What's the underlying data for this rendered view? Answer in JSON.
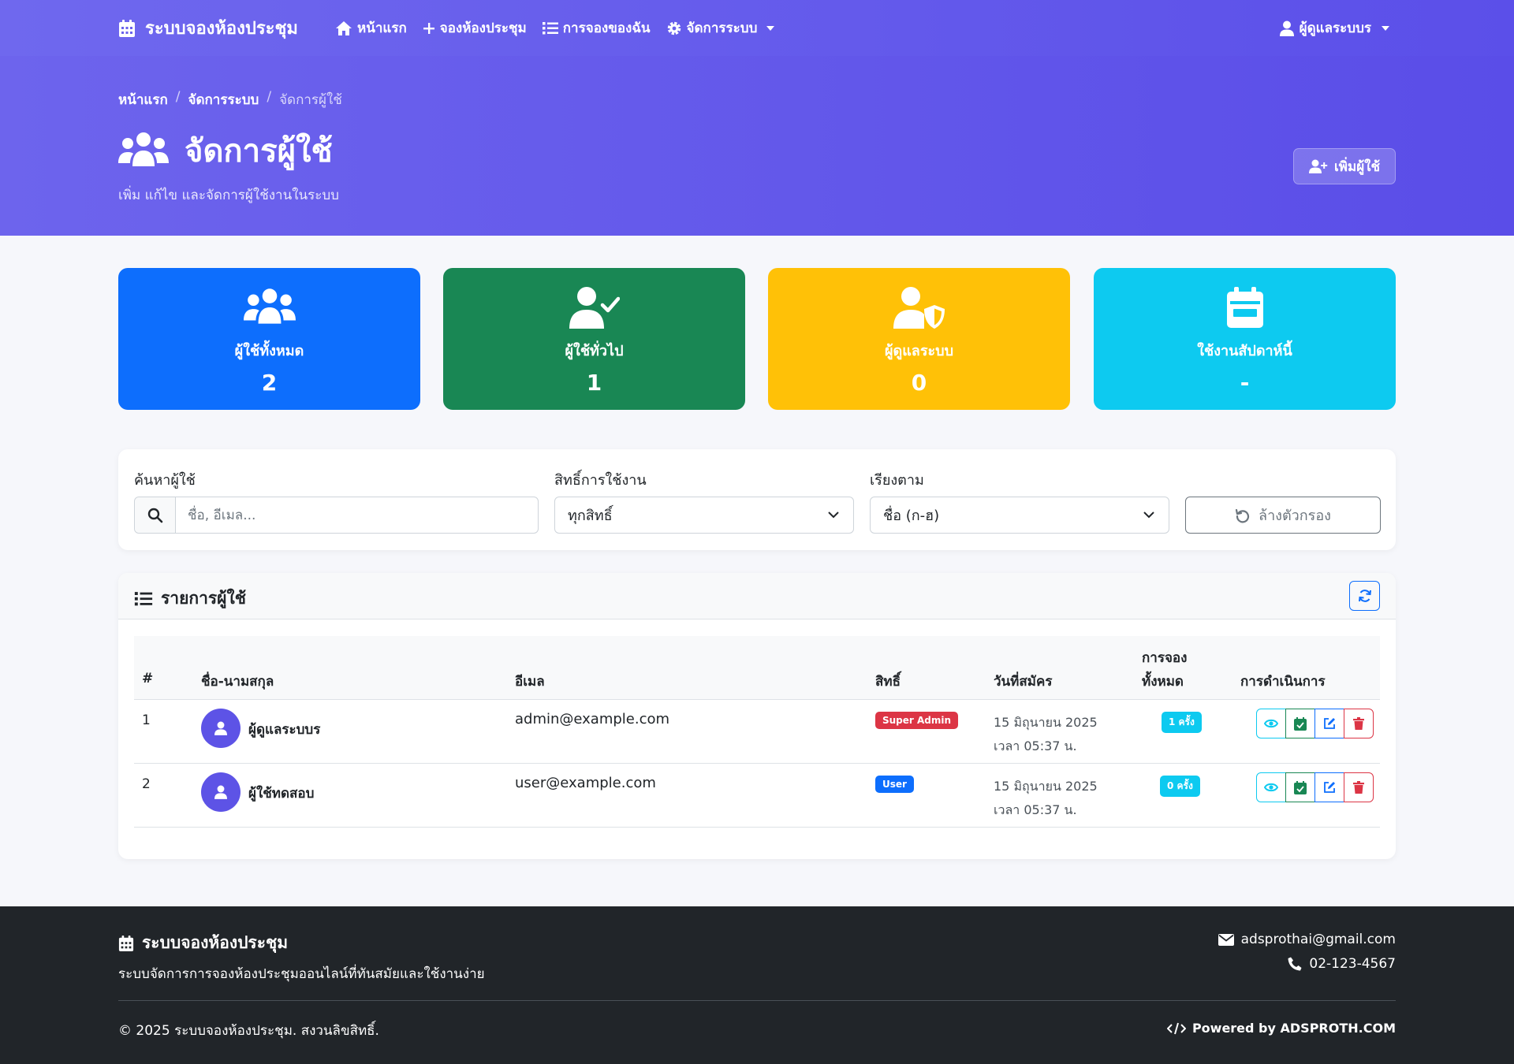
{
  "nav": {
    "brand": "ระบบจองห้องประชุม",
    "links": [
      {
        "label": "หน้าแรก",
        "icon": "home-icon"
      },
      {
        "label": "จองห้องประชุม",
        "icon": "plus-icon"
      },
      {
        "label": "การจองของฉัน",
        "icon": "list-icon"
      },
      {
        "label": "จัดการระบบ",
        "icon": "gear-icon"
      }
    ],
    "user": "ผู้ดูแลระบบร"
  },
  "header": {
    "breadcrumb": [
      "หน้าแรก",
      "จัดการระบบ",
      "จัดการผู้ใช้"
    ],
    "title": "จัดการผู้ใช้",
    "subtitle": "เพิ่ม แก้ไข และจัดการผู้ใช้งานในระบบ",
    "add_button": "เพิ่มผู้ใช้"
  },
  "stats": [
    {
      "label": "ผู้ใช้ทั้งหมด",
      "value": "2",
      "color": "#0d6efd",
      "icon": "users-icon"
    },
    {
      "label": "ผู้ใช้ทั่วไป",
      "value": "1",
      "color": "#198754",
      "icon": "user-check-icon"
    },
    {
      "label": "ผู้ดูแลระบบ",
      "value": "0",
      "color": "#ffc107",
      "icon": "user-shield-icon"
    },
    {
      "label": "ใช้งานสัปดาห์นี้",
      "value": "-",
      "color": "#0dcaf0",
      "icon": "calendar-icon"
    }
  ],
  "filters": {
    "search_label": "ค้นหาผู้ใช้",
    "search_placeholder": "ชื่อ, อีเมล...",
    "role_label": "สิทธิ์การใช้งาน",
    "role_value": "ทุกสิทธิ์",
    "sort_label": "เรียงตาม",
    "sort_value": "ชื่อ (ก-ฮ)",
    "clear_button": "ล้างตัวกรอง"
  },
  "table": {
    "title": "รายการผู้ใช้",
    "columns": [
      "#",
      "ชื่อ-นามสกุล",
      "อีเมล",
      "สิทธิ์",
      "วันที่สมัคร",
      "การจอง",
      "ทั้งหมด",
      "การดำเนินการ"
    ],
    "rows": [
      {
        "no": "1",
        "name": "ผู้ดูแลระบบร",
        "email": "admin@example.com",
        "role": "Super Admin",
        "role_color": "#dc3545",
        "date": "15 มิถุนายน 2025 เวลา 05:37 น.",
        "bookings": "1 ครั้ง"
      },
      {
        "no": "2",
        "name": "ผู้ใช้ทดสอบ",
        "email": "user@example.com",
        "role": "User",
        "role_color": "#0d6efd",
        "date": "15 มิถุนายน 2025 เวลา 05:37 น.",
        "bookings": "0 ครั้ง"
      }
    ]
  },
  "footer": {
    "brand": "ระบบจองห้องประชุม",
    "description": "ระบบจัดการการจองห้องประชุมออนไลน์ที่ทันสมัยและใช้งานง่าย",
    "email": "adsprothai@gmail.com",
    "phone": "02-123-4567",
    "copyright": "© 2025 ระบบจองห้องประชุม. สงวนลิขสิทธิ์.",
    "powered": "Powered by ADSPROTH.COM"
  }
}
